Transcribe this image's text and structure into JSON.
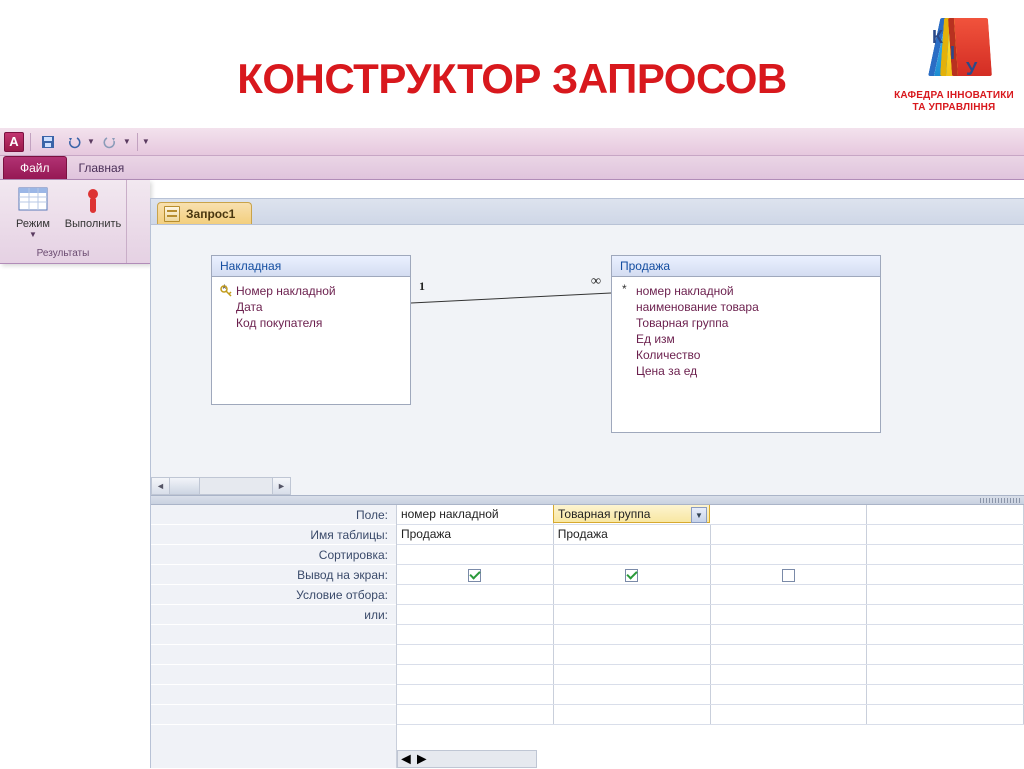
{
  "slide": {
    "title": "КОНСТРУКТОР ЗАПРОСОВ",
    "logo_letters": [
      "К",
      "І",
      "У"
    ],
    "logo_caption_line1": "КАФЕДРА ІННОВАТИКИ",
    "logo_caption_line2": "ТА УПРАВЛІННЯ"
  },
  "qat": {
    "app_letter": "A"
  },
  "tabs": {
    "file": "Файл",
    "home": "Главная"
  },
  "ribbon": {
    "btn_mode": "Режим",
    "btn_run": "Выполнить",
    "group_label": "Результаты"
  },
  "doc_tab": "Запрос1",
  "tables": {
    "box1": {
      "title": "Накладная",
      "fields": [
        "*",
        "Номер накладной",
        "Дата",
        "Код покупателя"
      ],
      "key_index": 1
    },
    "box2": {
      "title": "Продажа",
      "fields": [
        "*",
        "номер накладной",
        "наименование товара",
        "Товарная группа",
        "Ед изм",
        "Количество",
        "Цена за ед"
      ]
    }
  },
  "relation": {
    "left_label": "1",
    "right_label": "∞"
  },
  "grid": {
    "labels": [
      "Поле:",
      "Имя таблицы:",
      "Сортировка:",
      "Вывод на экран:",
      "Условие отбора:",
      "или:"
    ],
    "cols": [
      {
        "field": "номер накладной",
        "table": "Продажа",
        "show": true
      },
      {
        "field": "Товарная группа",
        "table": "Продажа",
        "show": true,
        "active": true
      },
      {
        "field": "",
        "table": "",
        "show": false
      },
      {
        "field": "",
        "table": "",
        "show": null
      }
    ]
  }
}
